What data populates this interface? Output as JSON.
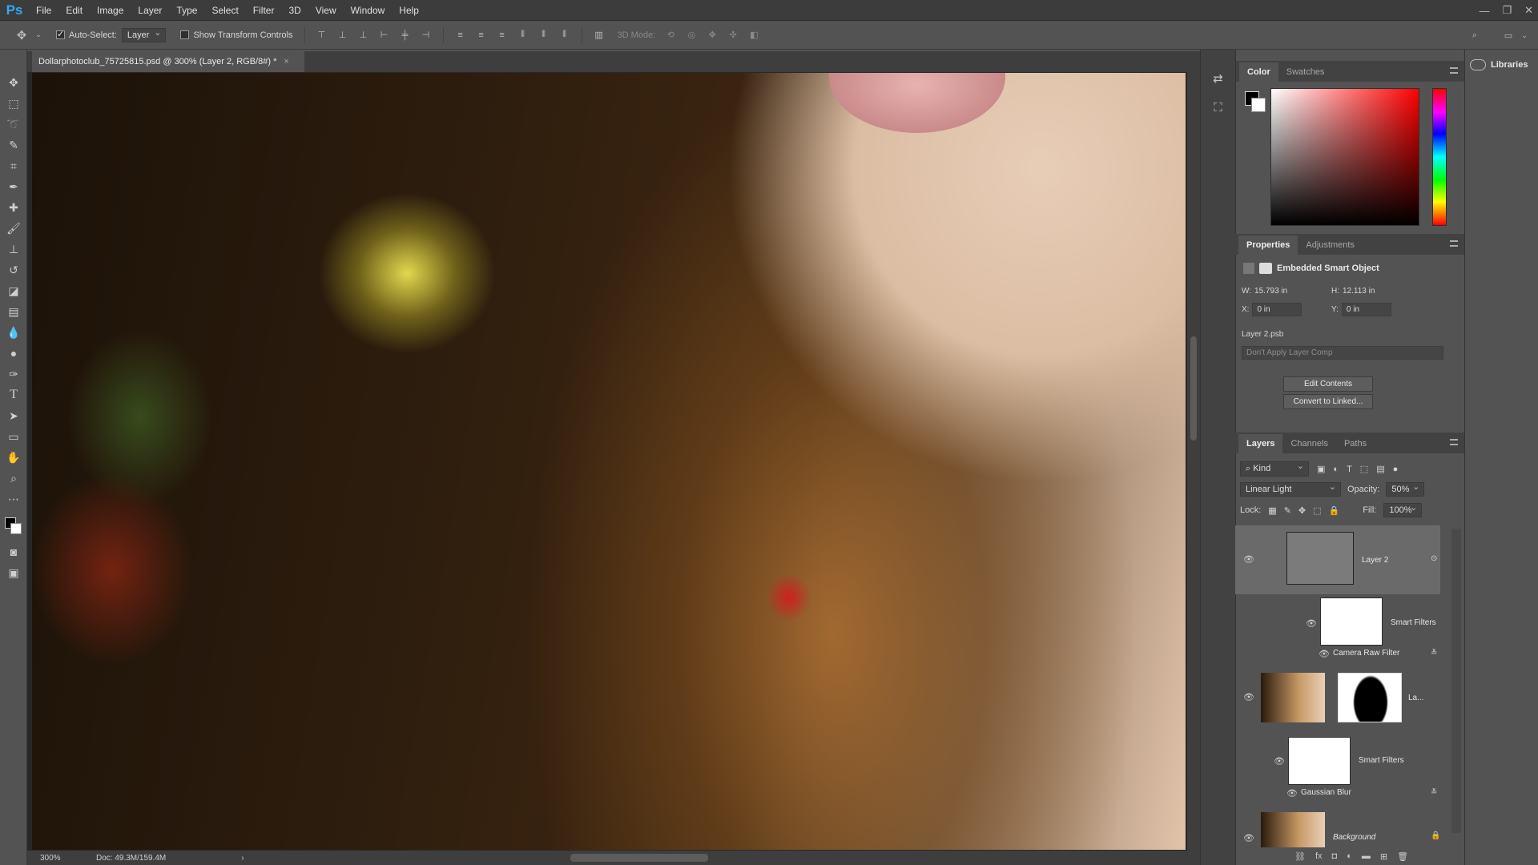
{
  "app": {
    "logo": "Ps"
  },
  "menu": [
    "File",
    "Edit",
    "Image",
    "Layer",
    "Type",
    "Select",
    "Filter",
    "3D",
    "View",
    "Window",
    "Help"
  ],
  "window_controls": [
    "—",
    "❐",
    "✕"
  ],
  "options": {
    "auto_select_label": "Auto-Select:",
    "auto_select_checked": true,
    "auto_select_value": "Layer",
    "transform_label": "Show Transform Controls",
    "mode_3d_label": "3D Mode:"
  },
  "document": {
    "tab_title": "Dollarphotoclub_75725815.psd @ 300% (Layer 2, RGB/8#) *",
    "close": "×",
    "zoom": "300%",
    "doc_size": "Doc: 49.3M/159.4M"
  },
  "color_panel": {
    "tabs": [
      "Color",
      "Swatches"
    ],
    "fg_color": "#000000",
    "bg_color": "#ffffff"
  },
  "properties": {
    "tabs": [
      "Properties",
      "Adjustments"
    ],
    "type": "Embedded Smart Object",
    "w_label": "W:",
    "w_value": "15.793 in",
    "h_label": "H:",
    "h_value": "12.113 in",
    "x_label": "X:",
    "x_value": "0 in",
    "y_label": "Y:",
    "y_value": "0 in",
    "file": "Layer 2.psb",
    "layer_comp": "Don't Apply Layer Comp",
    "edit_btn": "Edit Contents",
    "convert_btn": "Convert to Linked..."
  },
  "layers_panel": {
    "tabs": [
      "Layers",
      "Channels",
      "Paths"
    ],
    "filter_kind": "Kind",
    "blend_mode": "Linear Light",
    "opacity_label": "Opacity:",
    "opacity": "50%",
    "lock_label": "Lock:",
    "fill_label": "Fill:",
    "fill": "100%",
    "layers": [
      {
        "name": "Layer 2"
      },
      {
        "name": "Smart Filters"
      },
      {
        "name": "Camera Raw Filter"
      },
      {
        "name": "La..."
      },
      {
        "name": "Smart Filters"
      },
      {
        "name": "Gaussian Blur"
      },
      {
        "name": "Background"
      }
    ]
  },
  "libraries": {
    "label": "Libraries"
  }
}
